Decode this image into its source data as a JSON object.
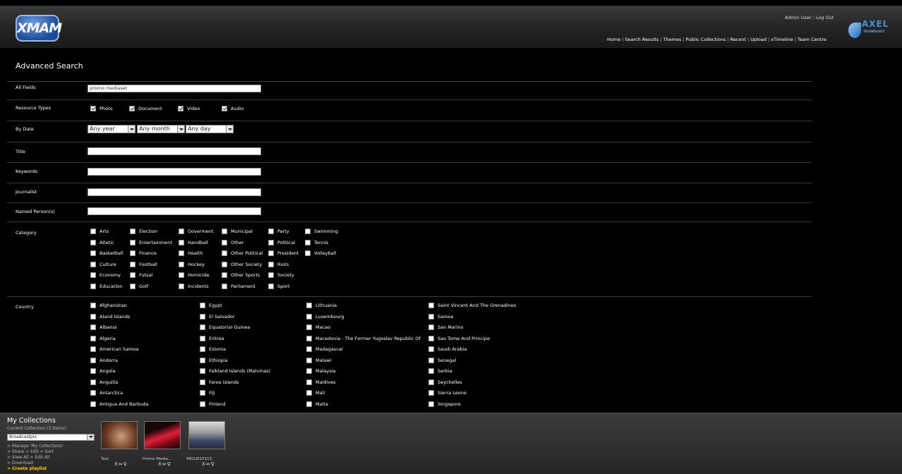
{
  "header": {
    "logo_text": "XMAM",
    "admin_user": "Admin User",
    "logout": "Log Out",
    "brand_name": "AXEL",
    "brand_sub": "TECHNOLOGY",
    "nav": [
      "Home",
      "Search Results",
      "Themes",
      "Public Collections",
      "Recent",
      "Upload",
      "xTimeline",
      "Team Centre"
    ]
  },
  "search": {
    "title": "Advanced Search",
    "all_fields_label": "All Fields",
    "all_fields_value": "promo mediaset",
    "resource_types_label": "Resource Types",
    "resource_types": [
      "Photo",
      "Document",
      "Video",
      "Audio"
    ],
    "by_date_label": "By Date",
    "year": "Any year",
    "month": "Any month",
    "day": "Any day",
    "title_label": "Title",
    "keywords_label": "Keywords",
    "journalist_label": "Journalist",
    "named_persons_label": "Named Person(s)",
    "category_label": "Category",
    "categories": [
      [
        "Arts",
        "Atletic",
        "Basketball",
        "Culture",
        "Economy",
        "Education"
      ],
      [
        "Election",
        "Entertainment",
        "Finance",
        "Football",
        "Futsal",
        "Golf"
      ],
      [
        "Goverment",
        "Handball",
        "Health",
        "Hockey",
        "Homicide",
        "Incidents"
      ],
      [
        "Municipal",
        "Other",
        "Other Political",
        "Other Society",
        "Other Sports",
        "Parliament"
      ],
      [
        "Party",
        "Political",
        "President",
        "Riots",
        "Society",
        "Sport"
      ],
      [
        "Swimming",
        "Tennis",
        "Volleyball"
      ]
    ],
    "country_label": "Country",
    "countries": [
      [
        "Afghanistan",
        "Aland Islands",
        "Albania",
        "Algeria",
        "American Samoa",
        "Andorra",
        "Angola",
        "Anguilla",
        "Antarctica",
        "Antigua And Barbuda"
      ],
      [
        "Egypt",
        "El Salvador",
        "Equatorial Guinea",
        "Eritrea",
        "Estonia",
        "Ethiopia",
        "Falkland Islands (Malvinas)",
        "Faroe Islands",
        "Fiji",
        "Finland"
      ],
      [
        "Lithuania",
        "Luxembourg",
        "Macao",
        "Macedonia - The Former Yugoslav Republic Of",
        "Madagascar",
        "Malawi",
        "Malaysia",
        "Maldives",
        "Mali",
        "Malta"
      ],
      [
        "Saint Vincent And The Grenadines",
        "Samoa",
        "San Marino",
        "Sao Tome And Principe",
        "Saudi Arabia",
        "Senegal",
        "Serbia",
        "Seychelles",
        "Sierra Leone",
        "Singapore"
      ]
    ]
  },
  "collections": {
    "title": "My Collections",
    "current": "Current Collection (3 items):",
    "selected": "Broadcastpix",
    "links": [
      "> Manage 'My Collections'",
      "> Share  > Edit  > Sort",
      "> View All  > Edit All",
      "> Download"
    ],
    "create_playlist": "> Create playlist",
    "items": [
      {
        "label": "Test",
        "tools": "X⇔♀"
      },
      {
        "label": "Promo Media...",
        "tools": "X⇔♀"
      },
      {
        "label": "MELU010113",
        "tools": "X⇔♀"
      }
    ]
  },
  "colors": {
    "background": "#000000",
    "header": "#2a2a2a",
    "brand_blue": "#3d94dd",
    "playlist_link": "#ffcc00"
  }
}
